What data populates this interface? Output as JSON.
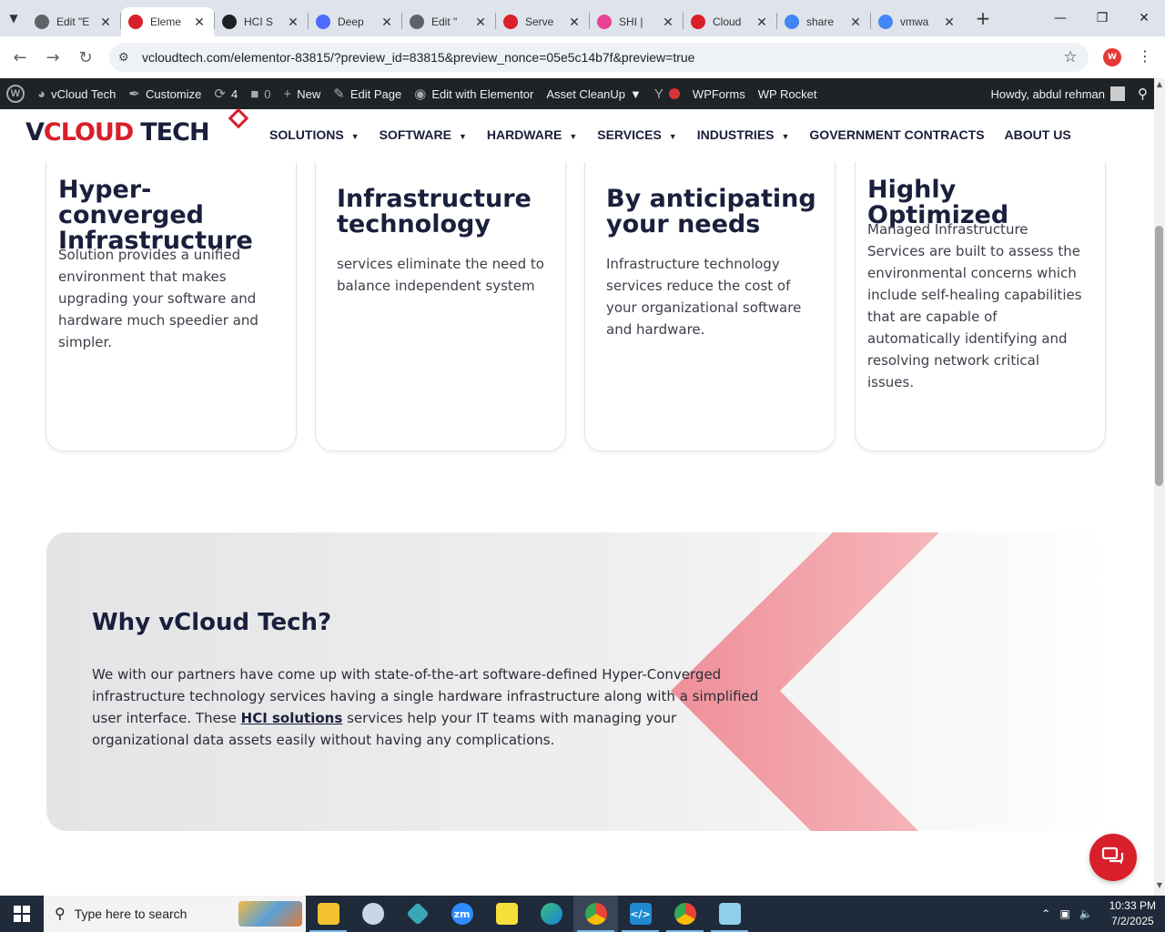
{
  "browser": {
    "tabs": [
      {
        "title": "Edit \"E",
        "icon": "wordpress-icon",
        "color": "#5f6368"
      },
      {
        "title": "Eleme",
        "icon": "vcloud-icon",
        "color": "#d81f2a",
        "active": true
      },
      {
        "title": "HCI S",
        "icon": "openai-icon",
        "color": "#202124"
      },
      {
        "title": "Deep",
        "icon": "deepseek-icon",
        "color": "#4d6bfe"
      },
      {
        "title": "Edit \"",
        "icon": "wordpress-icon",
        "color": "#5f6368"
      },
      {
        "title": "Serve",
        "icon": "vcloud-icon",
        "color": "#d81f2a"
      },
      {
        "title": "SHI | ",
        "icon": "shi-icon",
        "color": "#e84393"
      },
      {
        "title": "Cloud",
        "icon": "cloud-icon",
        "color": "#d81f2a"
      },
      {
        "title": "share",
        "icon": "google-icon",
        "color": "#4285f4"
      },
      {
        "title": "vmwa",
        "icon": "google-icon",
        "color": "#4285f4"
      }
    ],
    "url": "vcloudtech.com/elementor-83815/?preview_id=83815&preview_nonce=05e5c14b7f&preview=true",
    "profile_initial": "W"
  },
  "wpbar": {
    "site": "vCloud Tech",
    "customize": "Customize",
    "updates": "4",
    "comments": "0",
    "new": "New",
    "edit_page": "Edit Page",
    "edit_elementor": "Edit with Elementor",
    "asset_cleanup": "Asset CleanUp",
    "wpforms": "WPForms",
    "wprocket": "WP Rocket",
    "howdy": "Howdy, abdul rehman"
  },
  "site": {
    "logo_v": "V",
    "logo_cloud": "CLOUD",
    "logo_tech": "TECH",
    "nav": [
      {
        "label": "SOLUTIONS",
        "dropdown": true
      },
      {
        "label": "SOFTWARE",
        "dropdown": true
      },
      {
        "label": "HARDWARE",
        "dropdown": true
      },
      {
        "label": "SERVICES",
        "dropdown": true
      },
      {
        "label": "INDUSTRIES",
        "dropdown": true
      },
      {
        "label": "GOVERNMENT CONTRACTS",
        "dropdown": false
      },
      {
        "label": "ABOUT US",
        "dropdown": false
      }
    ]
  },
  "cards": [
    {
      "title_line1": "Hyper-converged",
      "title_line2": "Infrastructure",
      "body": "Solution provides a unified environment that makes upgrading your software and hardware much speedier and simpler."
    },
    {
      "title_line1": "Infrastructure",
      "title_line2": "technology",
      "body": "services eliminate the need to balance independent system"
    },
    {
      "title_line1": "By anticipating",
      "title_line2": "your needs",
      "body": "Infrastructure technology services reduce the cost of your organizational software and hardware."
    },
    {
      "title_line1": "Highly Optimized",
      "title_line2": "",
      "body": "Managed Infrastructure Services are built to assess the environmental concerns which include self-healing capabilities that are capable of automatically identifying and resolving network critical issues."
    }
  ],
  "why": {
    "heading": "Why vCloud Tech?",
    "text_before": "We with our partners have come up with state-of-the-art software-defined Hyper-Converged infrastructure technology services having a single hardware infrastructure along with a simplified user interface. These ",
    "link": "HCI solutions",
    "text_after": " services help your IT teams with managing your organizational data assets easily without having any complications."
  },
  "taskbar": {
    "search_placeholder": "Type here to search",
    "time": "10:33 PM",
    "date": "7/2/2025"
  },
  "colors": {
    "brand_red": "#d81f2a",
    "navy": "#1a1f3c",
    "wpbar": "#1d2327"
  }
}
